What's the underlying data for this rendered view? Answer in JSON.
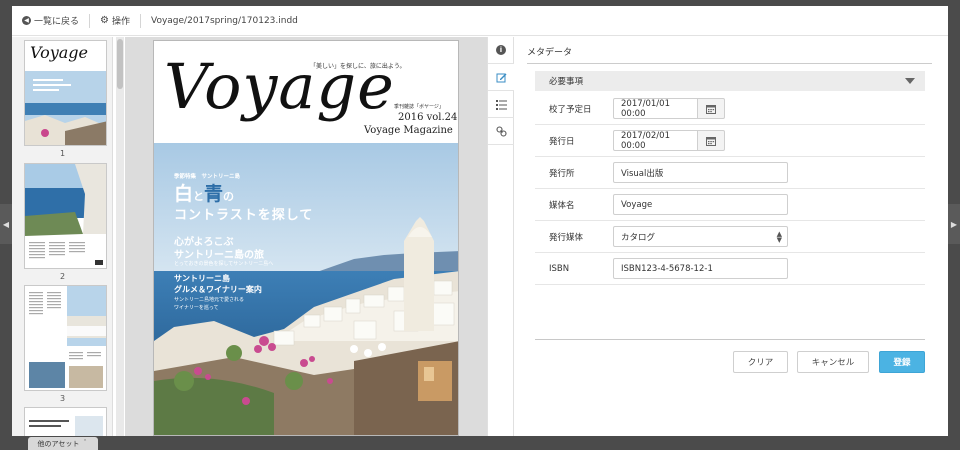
{
  "toolbar": {
    "back_label": "一覧に戻る",
    "operation_label": "操作",
    "path": "Voyage/2017spring/170123.indd"
  },
  "thumbnails": [
    {
      "page": "1"
    },
    {
      "page": "2"
    },
    {
      "page": "3"
    }
  ],
  "cover": {
    "title": "Voyage",
    "tagline": "「美しい」を探しに、旅に出よう。",
    "issue_small": "季刊雑誌「ボヤージ」",
    "issue": "2016 vol.24",
    "magazine": "Voyage Magazine",
    "feature_tag": "季節特集　サントリーニ島",
    "headline_big_1": "白",
    "headline_mid": "と",
    "headline_big_2": "青",
    "headline_end": "の",
    "headline_2": "コントラストを探して",
    "sub1_line1": "心がよろこぶ",
    "sub1_line2": "サントリーニ島の旅",
    "sub1_note": "とっておきの景色を探してサントリーニ島へ",
    "sub2_line1": "サントリーニ島",
    "sub2_line2": "グルメ＆ワイナリー案内",
    "sub2_note1": "サントリーニ島地元で愛される",
    "sub2_note2": "ワイナリーを巡って"
  },
  "metadata": {
    "heading": "メタデータ",
    "section": "必要事項",
    "fields": [
      {
        "label": "校了予定日",
        "value": "2017/01/01 00:00"
      },
      {
        "label": "発行日",
        "value": "2017/02/01 00:00"
      },
      {
        "label": "発行所",
        "value": "Visual出版"
      },
      {
        "label": "媒体名",
        "value": "Voyage"
      },
      {
        "label": "発行媒体",
        "value": "カタログ"
      },
      {
        "label": "ISBN",
        "value": "ISBN123-4-5678-12-1"
      }
    ],
    "buttons": {
      "clear": "クリア",
      "cancel": "キャンセル",
      "submit": "登録"
    }
  },
  "bottom_tab": "他のアセット ＾",
  "colors": {
    "accent": "#4bb3e3",
    "sea": "#4a8fc0",
    "sky": "#b9d4e8"
  }
}
